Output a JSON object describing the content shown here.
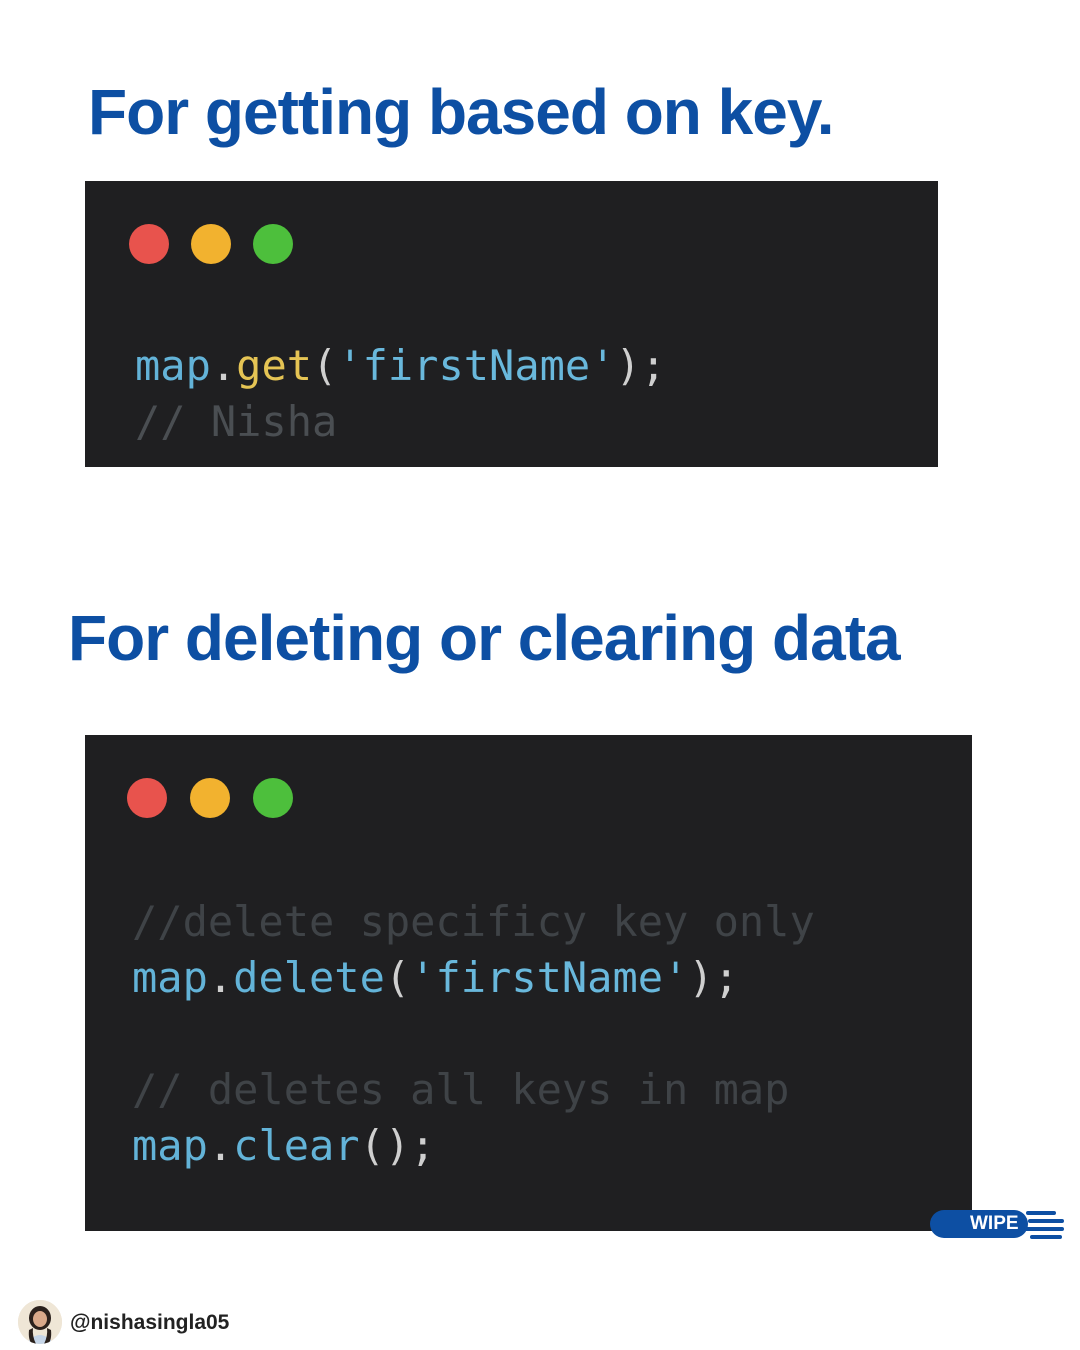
{
  "section1": {
    "heading": "For getting based on key.",
    "code": {
      "obj": "map",
      "dot": ".",
      "fn": "get",
      "open": "(",
      "arg": "'firstName'",
      "close": ");",
      "comment": "// Nisha"
    }
  },
  "section2": {
    "heading": "For deleting or clearing data",
    "code": {
      "comment1": "//delete specificy key only",
      "line1_obj": "map",
      "line1_dot": ".",
      "line1_fn": "delete",
      "line1_open": "(",
      "line1_arg": "'firstName'",
      "line1_close": ");",
      "comment2": "// deletes all keys in map",
      "line2_obj": "map",
      "line2_dot": ".",
      "line2_fn": "clear",
      "line2_call": "();"
    }
  },
  "window_dots": {
    "colors": [
      "#e8534d",
      "#f2b22f",
      "#4dbf3c"
    ]
  },
  "swipe_badge": {
    "label": "WIPE"
  },
  "footer": {
    "handle": "@nishasingla05"
  },
  "colors": {
    "heading": "#0d4fa3",
    "code_background": "#1f1f21"
  }
}
